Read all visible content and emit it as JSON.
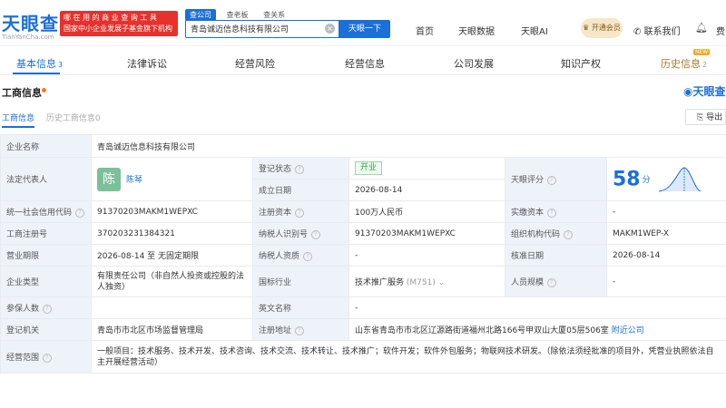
{
  "header": {
    "logo": "天眼查",
    "logo_sub": "TianYanCha.com",
    "promo_line1": "哪 在 用 的 商 业 查 询 工 具",
    "promo_line2": "国家中小企业发展子基金旗下机构",
    "search_tabs": [
      "查公司",
      "查老板",
      "查关系"
    ],
    "search_value": "青岛诚迈信息科技有限公司",
    "search_button": "天眼一下",
    "nav": [
      "首页",
      "天眼数据",
      "天眼AI"
    ],
    "vip_label": "开通会员",
    "contact": "联系我们",
    "user": "费"
  },
  "tabs": [
    {
      "label": "基本信息",
      "count": "3"
    },
    {
      "label": "法律诉讼",
      "count": ""
    },
    {
      "label": "经营风险",
      "count": ""
    },
    {
      "label": "经营信息",
      "count": ""
    },
    {
      "label": "公司发展",
      "count": ""
    },
    {
      "label": "知识产权",
      "count": ""
    },
    {
      "label": "历史信息",
      "count": "2"
    }
  ],
  "new_badge": "NEW",
  "section": {
    "title": "工商信息",
    "brand": "天眼查",
    "subtabs": [
      "工商信息",
      "历史工商信息0"
    ],
    "export": "导出"
  },
  "info": {
    "company_name_label": "企业名称",
    "company_name": "青岛诚迈信息科技有限公司",
    "legal_rep_label": "法定代表人",
    "avatar_char": "陈",
    "legal_rep": "陈琴",
    "reg_status_label": "登记状态",
    "reg_status": "开业",
    "score_label": "天眼评分",
    "score": "58",
    "score_unit": "分",
    "founded_label": "成立日期",
    "founded": "2026-08-14",
    "credit_code_label": "统一社会信用代码",
    "credit_code": "91370203MAKM1WEPXC",
    "capital_label": "注册资本",
    "capital": "100万人民币",
    "paid_capital_label": "实缴资本",
    "paid_capital": "-",
    "reg_no_label": "工商注册号",
    "reg_no": "370203231384321",
    "tax_id_label": "纳税人识别号",
    "tax_id": "91370203MAKM1WEPXC",
    "org_code_label": "组织机构代码",
    "org_code": "MAKM1WEP-X",
    "term_label": "营业期限",
    "term": "2026-08-14 至 无固定期限",
    "taxpayer_label": "纳税人资质",
    "taxpayer": "-",
    "approval_label": "核准日期",
    "approval": "2026-08-14",
    "type_label": "企业类型",
    "type": "有限责任公司（非自然人投资或控股的法人独资）",
    "industry_label": "国标行业",
    "industry": "技术推广服务",
    "industry_code": "(M751)",
    "size_label": "人员规模",
    "size": "-",
    "insured_label": "参保人数",
    "insured": "",
    "en_name_label": "英文名称",
    "en_name": "-",
    "authority_label": "登记机关",
    "authority": "青岛市市北区市场监督管理局",
    "address_label": "注册地址",
    "address": "山东省青岛市市北区辽源路街道福州北路166号甲双山大厦05层506室",
    "nearby": "附近公司",
    "scope_label": "经营范围",
    "scope": "一般项目：技术服务、技术开发、技术咨询、技术交流、技术转让、技术推广；软件开发；软件外包服务；物联网技术研发。（除依法须经批准的项目外，凭营业执照依法自主开展经营活动）"
  }
}
